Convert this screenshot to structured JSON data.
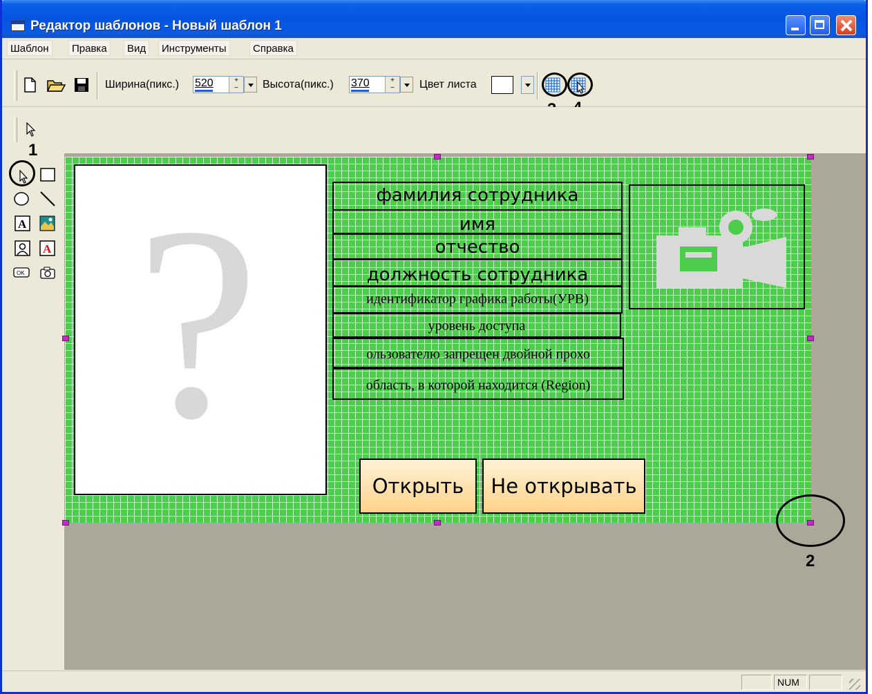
{
  "window": {
    "title": "Редактор шаблонов - Новый шаблон 1"
  },
  "menu": [
    "Шаблон",
    "Правка",
    "Вид",
    "Инструменты",
    "Справка"
  ],
  "toolbar": {
    "width_label": "Ширина(пикс.)",
    "width_value": "520",
    "height_label": "Высота(пикс.)",
    "height_value": "370",
    "color_label": "Цвет листа",
    "icons": [
      "new-file-icon",
      "open-folder-icon",
      "save-disk-icon",
      "grid-icon",
      "snap-to-grid-icon"
    ]
  },
  "callouts": {
    "c1": "1",
    "c2": "2",
    "c3": "3",
    "c4": "4"
  },
  "canvas": {
    "fields": [
      "фамилия сотрудника",
      "имя",
      "отчество",
      "должность сотрудника",
      "идентификатор графика работы(УРВ)",
      "уровень доступа",
      "ользователю запрещен двойной прохо",
      "область, в которой находится (Region)"
    ],
    "photo_placeholder": "?",
    "open_button": "Открыть",
    "noopen_button": "Не открывать",
    "grid_color": "#4ccd4c",
    "button_color": "#ffd28a"
  },
  "status": {
    "num": "NUM"
  }
}
